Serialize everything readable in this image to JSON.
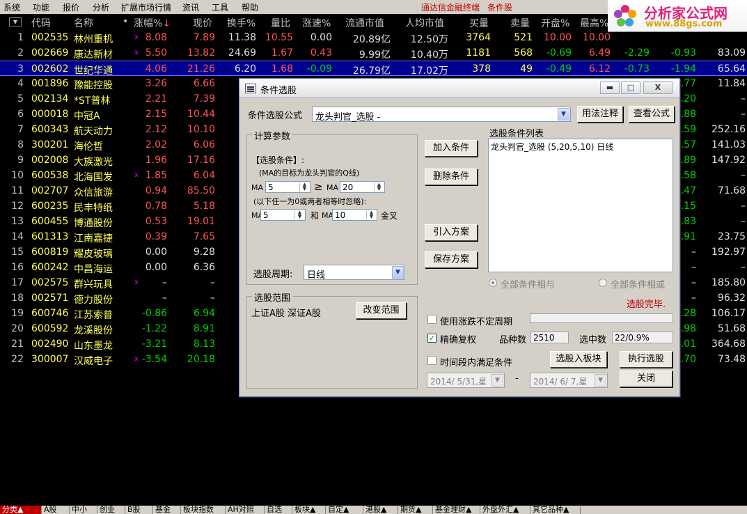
{
  "menu": {
    "items": [
      "系统",
      "功能",
      "报价",
      "分析",
      "扩展市场行情",
      "资讯",
      "工具",
      "帮助"
    ],
    "app_title": "通达信金融终端",
    "app_subtitle": "条件股"
  },
  "logo": {
    "text": "分析家公式网",
    "url": "www.88gs.com"
  },
  "columns": [
    "代码",
    "名称",
    "•",
    "涨幅%",
    "现价",
    "换手%",
    "量比",
    "涨速%",
    "流通市值",
    "人均市值",
    "买量",
    "卖量",
    "开盘%",
    "最高%"
  ],
  "sort_indicator": "↓",
  "rows": [
    {
      "idx": "1",
      "code": "002535",
      "name": "林州重机",
      "mark": "x",
      "chg": "8.08",
      "price": "7.89",
      "turn": "11.38",
      "vol": "10.55",
      "spd": "0.00",
      "cap": "20.89亿",
      "per": "12.50万",
      "buy": "3764",
      "sell": "521",
      "open": "10.00",
      "high": "10.00",
      "c15": "",
      "c16": "",
      "last": "",
      "dir": "up",
      "spd_dir": "flat",
      "open_dir": "up",
      "high_dir": "up",
      "c15_dir": "up",
      "c16_dir": "up"
    },
    {
      "idx": "2",
      "code": "002669",
      "name": "康达新材",
      "mark": "x",
      "chg": "5.50",
      "price": "13.82",
      "turn": "24.69",
      "vol": "1.67",
      "spd": "0.43",
      "cap": "9.99亿",
      "per": "10.40万",
      "buy": "1181",
      "sell": "568",
      "open": "-0.69",
      "high": "6.49",
      "c15": "-2.29",
      "c16": "-0.93",
      "last": "83.09",
      "dir": "up",
      "spd_dir": "up",
      "open_dir": "down",
      "high_dir": "up",
      "c15_dir": "down",
      "c16_dir": "down"
    },
    {
      "idx": "3",
      "code": "002602",
      "name": "世纪华通",
      "mark": "",
      "chg": "4.06",
      "price": "21.26",
      "turn": "6.20",
      "vol": "1.68",
      "spd": "-0.09",
      "cap": "26.79亿",
      "per": "17.02万",
      "buy": "378",
      "sell": "49",
      "open": "-0.49",
      "high": "6.12",
      "c15": "-0.73",
      "c16": "-1.94",
      "last": "65.64",
      "dir": "up",
      "spd_dir": "down",
      "open_dir": "down",
      "high_dir": "up",
      "c15_dir": "down",
      "c16_dir": "down"
    },
    {
      "idx": "4",
      "code": "001896",
      "name": "豫能控股",
      "mark": "",
      "chg": "3.26",
      "price": "6.66",
      "c16": ".77",
      "last": "11.84",
      "dir": "up",
      "c16_dir": "down"
    },
    {
      "idx": "5",
      "code": "002134",
      "name": "*ST普林",
      "mark": "",
      "chg": "2.21",
      "price": "7.39",
      "c16": ".20",
      "last": "–",
      "dir": "up",
      "c16_dir": "down"
    },
    {
      "idx": "6",
      "code": "000018",
      "name": "中冠A",
      "mark": "",
      "chg": "2.15",
      "price": "10.44",
      "c16": ".88",
      "last": "–",
      "dir": "up",
      "c16_dir": "down"
    },
    {
      "idx": "7",
      "code": "600343",
      "name": "航天动力",
      "mark": "",
      "chg": "2.12",
      "price": "10.10",
      "c16": ".59",
      "last": "252.16",
      "dir": "up",
      "c16_dir": "down"
    },
    {
      "idx": "8",
      "code": "300201",
      "name": "海伦哲",
      "mark": "",
      "chg": "2.02",
      "price": "6.06",
      "c16": ".57",
      "last": "141.03",
      "dir": "up",
      "c16_dir": "down"
    },
    {
      "idx": "9",
      "code": "002008",
      "name": "大族激光",
      "mark": "",
      "chg": "1.96",
      "price": "17.16",
      "c16": ".89",
      "last": "147.92",
      "dir": "up",
      "c16_dir": "down"
    },
    {
      "idx": "10",
      "code": "600538",
      "name": "北海国发",
      "mark": "x",
      "chg": "1.85",
      "price": "6.04",
      "c16": ".58",
      "last": "–",
      "dir": "up",
      "c16_dir": "down"
    },
    {
      "idx": "11",
      "code": "002707",
      "name": "众信旅游",
      "mark": "",
      "chg": "0.94",
      "price": "85.50",
      "c16": ".47",
      "last": "71.68",
      "dir": "up",
      "c16_dir": "down"
    },
    {
      "idx": "12",
      "code": "600235",
      "name": "民丰特纸",
      "mark": "",
      "chg": "0.78",
      "price": "5.18",
      "c16": ".15",
      "last": "–",
      "dir": "up",
      "c16_dir": "down"
    },
    {
      "idx": "13",
      "code": "600455",
      "name": "博通股份",
      "mark": "",
      "chg": "0.53",
      "price": "19.01",
      "c16": ".83",
      "last": "–",
      "dir": "up",
      "c16_dir": "down"
    },
    {
      "idx": "14",
      "code": "601313",
      "name": "江南嘉捷",
      "mark": "",
      "chg": "0.39",
      "price": "7.65",
      "c16": ".91",
      "last": "23.75",
      "dir": "up",
      "c16_dir": "down"
    },
    {
      "idx": "15",
      "code": "600819",
      "name": "耀皮玻璃",
      "mark": "",
      "chg": "0.00",
      "price": "9.28",
      "c16": "–",
      "last": "192.97",
      "dir": "flat",
      "c16_dir": "flat"
    },
    {
      "idx": "16",
      "code": "600242",
      "name": "中昌海运",
      "mark": "",
      "chg": "0.00",
      "price": "6.36",
      "c16": "–",
      "last": "–",
      "dir": "flat",
      "c16_dir": "flat"
    },
    {
      "idx": "17",
      "code": "002575",
      "name": "群兴玩具",
      "mark": "x",
      "chg": "–",
      "price": "–",
      "c16": "–",
      "last": "185.80",
      "dir": "flat",
      "c16_dir": "flat"
    },
    {
      "idx": "18",
      "code": "002571",
      "name": "德力股份",
      "mark": "",
      "chg": "–",
      "price": "–",
      "c16": "–",
      "last": "96.32",
      "dir": "flat",
      "c16_dir": "flat"
    },
    {
      "idx": "19",
      "code": "600746",
      "name": "江苏索普",
      "mark": "",
      "chg": "-0.86",
      "price": "6.94",
      "c16": ".28",
      "last": "106.17",
      "dir": "down",
      "c16_dir": "down"
    },
    {
      "idx": "20",
      "code": "600592",
      "name": "龙溪股份",
      "mark": "",
      "chg": "-1.22",
      "price": "8.91",
      "c16": ".98",
      "last": "51.68",
      "dir": "down",
      "c16_dir": "down"
    },
    {
      "idx": "21",
      "code": "002490",
      "name": "山东墨龙",
      "mark": "",
      "chg": "-3.21",
      "price": "8.13",
      "c16": ".01",
      "last": "364.68",
      "dir": "down",
      "c16_dir": "down"
    },
    {
      "idx": "22",
      "code": "300007",
      "name": "汉威电子",
      "mark": "x",
      "chg": "-3.54",
      "price": "20.18",
      "c16": ".70",
      "last": "73.48",
      "dir": "down",
      "c16_dir": "down"
    }
  ],
  "tabs": [
    "分类▲",
    "A股",
    "中小",
    "创业",
    "B股",
    "基金",
    "板块指数",
    "AH对照",
    "自选",
    "板块▲",
    "自定▲",
    "港股▲",
    "期货▲",
    "基金理财▲",
    "外盘外汇▲",
    "其它品种▲"
  ],
  "dialog": {
    "title": "条件选股",
    "formula_label": "条件选股公式",
    "formula_value": "龙头判官_选股 -",
    "btn_usage": "用法注释",
    "btn_view": "查看公式",
    "params_title": "计算参数",
    "cond_heading": "【选股条件】:",
    "cond_desc": "(MA的目标为龙头判官的Q线)",
    "ma_label": "MA",
    "ma1": "5",
    "ge_symbol": "≥",
    "ma2": "20",
    "note": "(以下任一为0或两者相等时忽略):",
    "ma3": "5",
    "and_label": "和",
    "ma4": "10",
    "cross_label": "金叉",
    "period_label": "选股周期:",
    "period_value": "日线",
    "btn_add": "加入条件",
    "btn_delete": "删除条件",
    "btn_import": "引入方案",
    "btn_save": "保存方案",
    "list_title": "选股条件列表",
    "list_items": [
      "龙头判官_选股 (5,20,5,10) 日线"
    ],
    "radio_and": "全部条件相与",
    "radio_or": "全部条件相或",
    "status": "选股完毕.",
    "scope_title": "选股范围",
    "scope_value": "上证A股 深证A股",
    "btn_scope": "改变范围",
    "chk_period": "使用涨跌不定周期",
    "chk_precise": "精确复权",
    "count_label": "品种数",
    "count_value": "2510",
    "selected_label": "选中数",
    "selected_value": "22/0.9%",
    "chk_range": "时间段内满足条件",
    "btn_to_board": "选股入板块",
    "btn_run": "执行选股",
    "date_from": "2014/ 5/31,星",
    "date_sep": "-",
    "date_to": "2014/ 6/ 7,星",
    "btn_close": "关闭",
    "win_min": "▬",
    "win_max": "□",
    "win_close": "X"
  }
}
